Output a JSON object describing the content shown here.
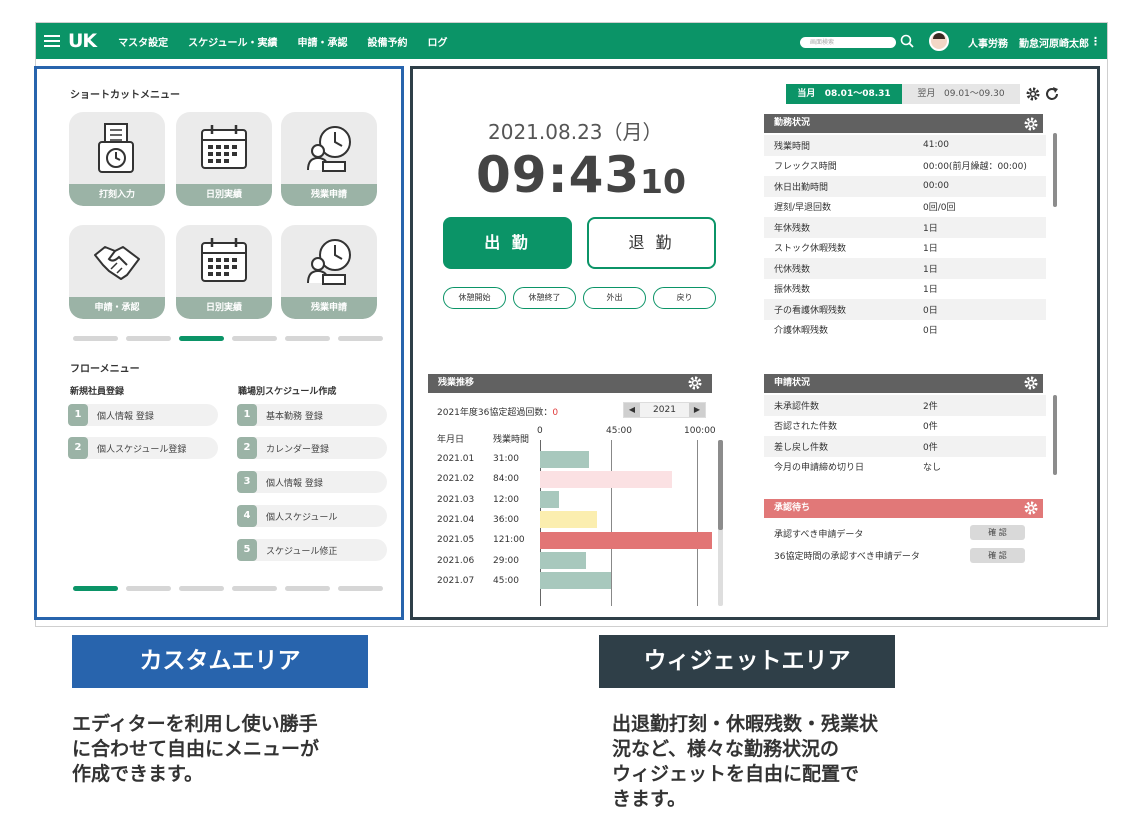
{
  "app": {
    "logo": "UK",
    "nav": [
      "マスタ設定",
      "スケジュール・実績",
      "申請・承認",
      "設備予約",
      "ログ"
    ],
    "search_placeholder": "画面検索",
    "department": "人事労務",
    "user": "勤怠河原崎太郎",
    "brand_color": "#0b9467"
  },
  "custom_area": {
    "shortcut_title": "ショートカットメニュー",
    "tiles": [
      {
        "label": "打刻入力",
        "icon": "punch-card-clock-icon"
      },
      {
        "label": "日別実績",
        "icon": "calendar-icon"
      },
      {
        "label": "残業申請",
        "icon": "overtime-worker-clock-icon"
      },
      {
        "label": "申請・承認",
        "icon": "handshake-icon"
      },
      {
        "label": "日別実績",
        "icon": "calendar-icon"
      },
      {
        "label": "残業申請",
        "icon": "overtime-worker-clock-icon"
      }
    ],
    "shortcut_page": 3,
    "flow_title": "フローメニュー",
    "flow_left_title": "新規社員登録",
    "flow_left": [
      {
        "num": "1",
        "label": "個人情報 登録"
      },
      {
        "num": "2",
        "label": "個人スケジュール登録"
      }
    ],
    "flow_right_title": "職場別スケジュール作成",
    "flow_right": [
      {
        "num": "1",
        "label": "基本勤務 登録"
      },
      {
        "num": "2",
        "label": "カレンダー登録"
      },
      {
        "num": "3",
        "label": "個人情報 登録"
      },
      {
        "num": "4",
        "label": "個人スケジュール"
      },
      {
        "num": "5",
        "label": "スケジュール修正"
      }
    ],
    "flow_page": 1
  },
  "clock": {
    "date": "2021.08.23（月）",
    "time": "09:43",
    "seconds": "10",
    "clock_in": "出 勤",
    "clock_out": "退 勤",
    "small_buttons": [
      "休憩開始",
      "休憩終了",
      "外出",
      "戻り"
    ]
  },
  "period": {
    "current_label": "当月",
    "current_range": "08.01〜08.31",
    "next_label": "翌月",
    "next_range": "09.01〜09.30"
  },
  "work_status": {
    "title": "勤務状況",
    "rows": [
      {
        "k": "残業時間",
        "v": "41:00"
      },
      {
        "k": "フレックス時間",
        "v": "00:00(前月繰越：00:00)"
      },
      {
        "k": "休日出勤時間",
        "v": "00:00"
      },
      {
        "k": "遅刻/早退回数",
        "v": "0回/0回"
      },
      {
        "k": "年休残数",
        "v": "1日"
      },
      {
        "k": "ストック休暇残数",
        "v": "1日"
      },
      {
        "k": "代休残数",
        "v": "1日"
      },
      {
        "k": "振休残数",
        "v": "1日"
      },
      {
        "k": "子の看護休暇残数",
        "v": "0日"
      },
      {
        "k": "介護休暇残数",
        "v": "0日"
      }
    ]
  },
  "overtime": {
    "title": "残業推移",
    "exceed_label": "2021年度36協定超過回数：",
    "exceed_count": "0",
    "year": "2021",
    "col_month": "年月日",
    "col_hours": "残業時間",
    "axis_ticks": [
      "0",
      "45:00",
      "100:00"
    ]
  },
  "chart_data": {
    "type": "bar",
    "categories": [
      "2021.01",
      "2021.02",
      "2021.03",
      "2021.04",
      "2021.05",
      "2021.06",
      "2021.07"
    ],
    "labels": [
      "31:00",
      "84:00",
      "12:00",
      "36:00",
      "121:00",
      "29:00",
      "45:00"
    ],
    "values": [
      31,
      84,
      12,
      36,
      121,
      29,
      45
    ],
    "colors": [
      "#a8c8bd",
      "#fbe1e3",
      "#a8c8bd",
      "#fbeeaf",
      "#e27575",
      "#a8c8bd",
      "#a8c8bd"
    ],
    "xlim": [
      0,
      100
    ]
  },
  "requests": {
    "title": "申請状況",
    "rows": [
      {
        "k": "未承認件数",
        "v": "2件"
      },
      {
        "k": "否認された件数",
        "v": "0件"
      },
      {
        "k": "差し戻し件数",
        "v": "0件"
      },
      {
        "k": "今月の申請締め切り日",
        "v": "なし"
      }
    ]
  },
  "approval": {
    "title": "承認待ち",
    "rows": [
      {
        "k": "承認すべき申請データ",
        "btn": "確 認"
      },
      {
        "k": "36協定時間の承認すべき申請データ",
        "btn": "確 認"
      }
    ]
  },
  "captions": {
    "custom_title": "カスタムエリア",
    "custom_desc": [
      "エディターを利用し使い勝手",
      "に合わせて自由にメニューが",
      "作成できます。"
    ],
    "widget_title": "ウィジェットエリア",
    "widget_desc": [
      "出退勤打刻・休暇残数・残業状",
      "況など、様々な勤務状況の",
      "ウィジェットを自由に配置で",
      "きます。"
    ]
  }
}
